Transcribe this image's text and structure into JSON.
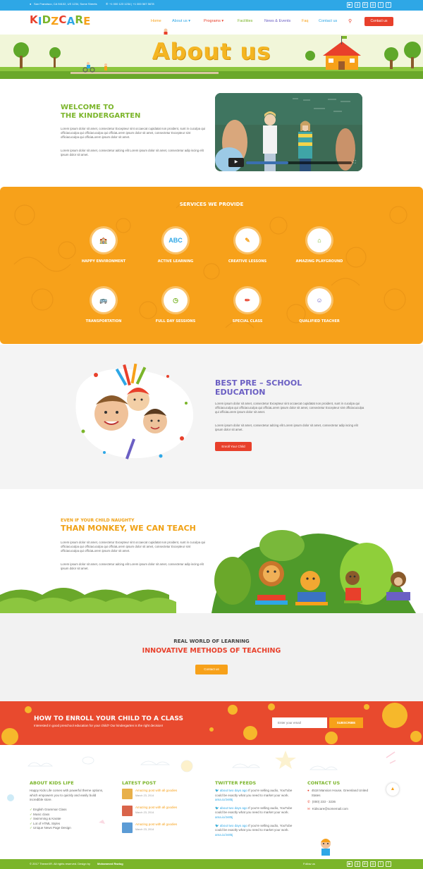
{
  "topbar": {
    "address": "San Francisco, CA 94102, US 1234, Some Streets",
    "phones": "+1 000 123 1234  |  +1 000 567 5678",
    "social": [
      "YouTube",
      "Google+",
      "LinkedIn",
      "Dribbble",
      "Twitter",
      "Facebook"
    ]
  },
  "header": {
    "logo": [
      "K",
      "I",
      "D",
      "Z",
      "C",
      "A",
      "R",
      "E"
    ],
    "logo_colors": [
      "#e8402b",
      "#2ea7e6",
      "#7bb52a",
      "#f7a11a",
      "#e8402b",
      "#2ea7e6",
      "#7bb52a",
      "#f7a11a"
    ],
    "nav": [
      {
        "label": "Home",
        "color": "#f7a11a"
      },
      {
        "label": "About us",
        "color": "#2ea7e6",
        "caret": true
      },
      {
        "label": "Programs",
        "color": "#e8402b",
        "caret": true
      },
      {
        "label": "Facilities",
        "color": "#7bb52a"
      },
      {
        "label": "News & Events",
        "color": "#6b5fc3"
      },
      {
        "label": "Faq",
        "color": "#f7a11a"
      },
      {
        "label": "Contact us",
        "color": "#2ea7e6"
      }
    ],
    "contact_button": "Contact us"
  },
  "hero": {
    "title": "About us"
  },
  "welcome": {
    "title1": "WELCOME TO",
    "title2": "THE KINDERGARTEN",
    "para1": "Lorem ipsum dolor sit amet, consectetur Excepteur sint occaecat cupidatat non proident, sunt in cuculpa qui officiacuculpa qui officiacuculpa qui officiaLorem ipsum dolor sit amet, consectetur Excepteur sint officiacuculpa qui officiaLorem ipsum dolor sit amet.",
    "para2": "Lorem ipsum dolor sit amet, consectetur adcing elit Lorem ipsum dolor sit amet, consectetur adip iscing elit ipsum dolor sit amet."
  },
  "services": {
    "title": "SERVICES WE PROVIDE",
    "items": [
      {
        "label": "HAPPY ENVIRONMENT",
        "icon": "school-icon"
      },
      {
        "label": "ACTIVE LEARNING",
        "icon": "abc-blocks-icon"
      },
      {
        "label": "CREATIVE LESSONS",
        "icon": "paint-icon"
      },
      {
        "label": "AMAZING PLAYGROUND",
        "icon": "playground-icon"
      },
      {
        "label": "TRANSPORTATION",
        "icon": "school-bus-icon"
      },
      {
        "label": "FULL DAY SESSIONS",
        "icon": "clock-icon"
      },
      {
        "label": "SPECIAL CLASS",
        "icon": "pencil-icon"
      },
      {
        "label": "QUALIFIED TEACHER",
        "icon": "teacher-icon"
      }
    ]
  },
  "preschool": {
    "title1": "BEST PRE – SCHOOL",
    "title2": "EDUCATION",
    "para1": "Lorem ipsum dolor sit amet, consectetur Excepteur sint occaecat cupidatat non proident, sunt in cuculpa qui officiacuculpa qui officiacuculpa qui officiaLorem ipsum dolor sit amet, consectetur Excepteur sint officiacuculpa qui officiaLorem ipsum dolor sit amet.",
    "para2": "Lorem ipsum dolor sit amet, consectetur adcing elit Lorem ipsum dolor sit amet, consectetur adip iscing elit ipsum dolor sit amet.",
    "button": "Enroll Your Child"
  },
  "monkey": {
    "subtitle": "EVEN IF YOUR CHILD NAUGHTY",
    "title": "THAN MONKEY, WE CAN TEACH",
    "para1": "Lorem ipsum dolor sit amet, consectetur Excepteur sint occaecat cupidatat non proident, sunt in cuculpa qui officiacuculpa qui officiacuculpa qui officiaLorem ipsum dolor sit amet, consectetur Excepteur sint officiacuculpa qui officiaLorem ipsum dolor sit amet.",
    "para2": "Lorem ipsum dolor sit amet, consectetur adcing elit Lorem ipsum dolor sit amet, consectetur adip iscing elit ipsum dolor sit amet."
  },
  "methods": {
    "subtitle": "REAL WORLD OF LEARNING",
    "title": "INNOVATIVE METHODS OF TEACHING",
    "button": "Contact us"
  },
  "enroll": {
    "title": "HOW TO ENROLL YOUR CHILD TO A CLASS",
    "subtitle": "Interested in good preschool education for your child? Our kindergarten is the right decision!",
    "email_placeholder": "Enter your email",
    "button": "SUBSCRIBE"
  },
  "footer": {
    "about": {
      "title": "ABOUT KIDS LIFE",
      "text": "Happy Kids Life comes with powerful theme options, which empowers you to quickly and easily build incredible store.",
      "list": [
        "English Grammar Class",
        "Music class",
        "Swimming & Karate",
        "Lot of HTML Styles",
        "Unique News Page Design"
      ]
    },
    "latest": {
      "title": "LATEST POST",
      "posts": [
        {
          "title": "Amazing post with all goodies",
          "date": "March 23, 2014"
        },
        {
          "title": "Amazing post with all goodies",
          "date": "March 23, 2014"
        },
        {
          "title": "Amazing post with all goodies",
          "date": "March 23, 2014"
        }
      ]
    },
    "twitter": {
      "title": "TWITTER FEEDS",
      "tweets": [
        {
          "link": "about two days ago",
          "text": "If you're selling audio, YouTube could be exactly what you need to market your work.",
          "url": "ama.io/Jv85j"
        },
        {
          "link": "about two days ago",
          "text": "If you're selling audio, YouTube could be exactly what you need to market your work.",
          "url": "ama.io/Jv85j"
        },
        {
          "link": "about two days ago",
          "text": "If you're selling audio, YouTube could be exactly what you need to market your work.",
          "url": "ama.io/Jv85j"
        }
      ]
    },
    "contact": {
      "title": "CONTACT US",
      "address": "4518 Mansion House, Greenland United States",
      "phone": "(000) 233 - 3236",
      "email": "Kidscare@somemail.com"
    }
  },
  "bottombar": {
    "copyright": "© 2017 ThemeXR. All rights reserved. Design by",
    "author": "Mohammed Rwdog",
    "follow": "Follow us"
  }
}
